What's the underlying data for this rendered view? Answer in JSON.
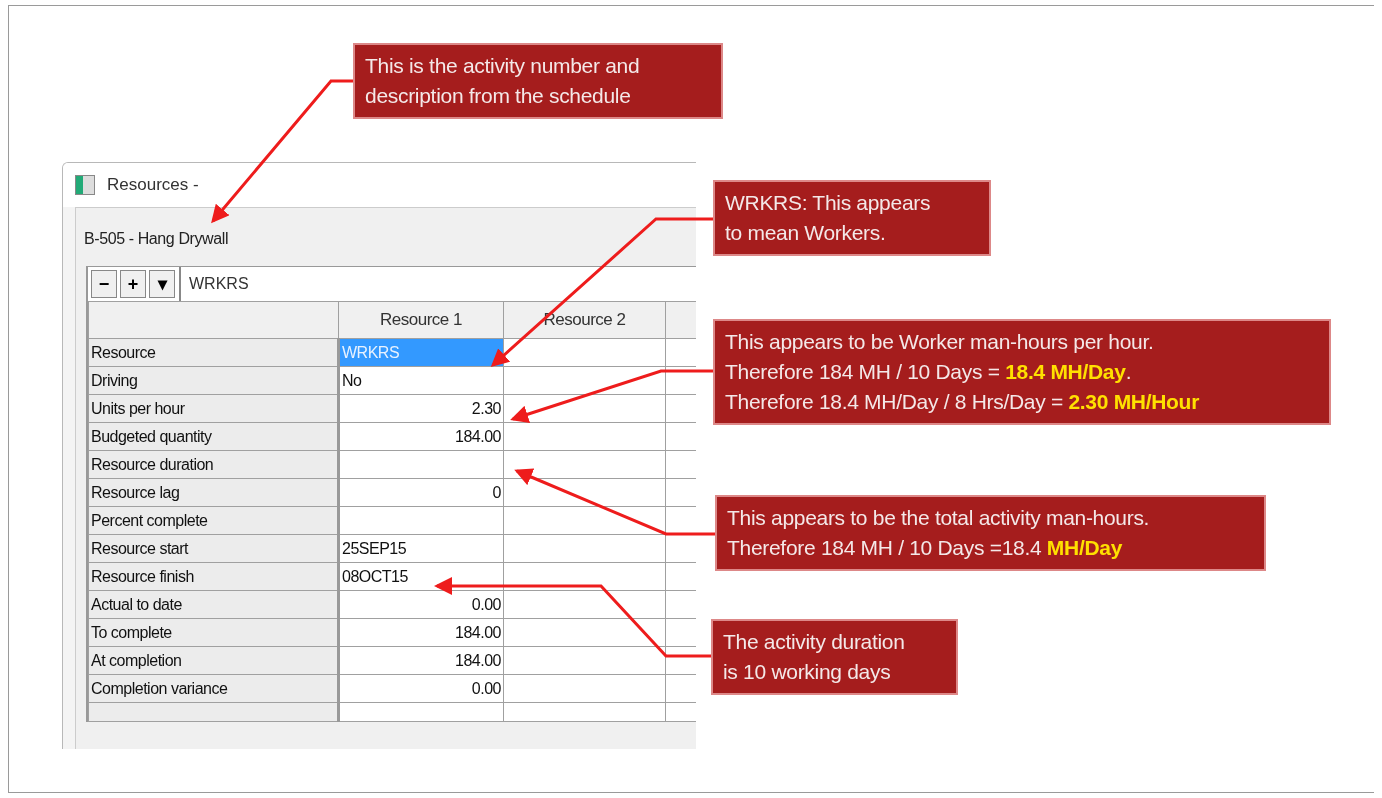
{
  "window": {
    "title": "Resources -",
    "activity": "B-505 - Hang Drywall"
  },
  "toolbar": {
    "buttons": [
      "−",
      "+",
      "▾"
    ],
    "value": "WRKRS"
  },
  "grid": {
    "columns": [
      "Resource 1",
      "Resource 2"
    ],
    "rows": [
      {
        "label": "Resource",
        "value": "WRKRS",
        "kind": "text",
        "selected": true
      },
      {
        "label": "Driving",
        "value": "No",
        "kind": "text",
        "selected": false
      },
      {
        "label": "Units per hour",
        "value": "2.30",
        "kind": "number",
        "selected": false
      },
      {
        "label": "Budgeted quantity",
        "value": "184.00",
        "kind": "number",
        "selected": false
      },
      {
        "label": "Resource duration",
        "selected": false
      },
      {
        "label": "Resource lag",
        "value": "0",
        "kind": "number",
        "selected": false
      },
      {
        "label": "Percent complete",
        "selected": false
      },
      {
        "label": "Resource start",
        "value": "25SEP15",
        "kind": "text",
        "selected": false
      },
      {
        "label": "Resource finish",
        "value": "08OCT15",
        "kind": "text",
        "selected": false
      },
      {
        "label": "Actual to date",
        "value": "0.00",
        "kind": "number",
        "selected": false
      },
      {
        "label": "To complete",
        "value": "184.00",
        "kind": "number",
        "selected": false
      },
      {
        "label": "At completion",
        "value": "184.00",
        "kind": "number",
        "selected": false
      },
      {
        "label": "Completion variance",
        "value": "0.00",
        "kind": "number",
        "selected": false
      }
    ]
  },
  "callouts": [
    {
      "lines": [
        [
          {
            "text": "This is the activity number and",
            "highlight": false
          }
        ],
        [
          {
            "text": "description from the schedule",
            "highlight": false
          }
        ]
      ]
    },
    {
      "lines": [
        [
          {
            "text": "WRKRS: This appears",
            "highlight": false
          }
        ],
        [
          {
            "text": "to mean Workers.",
            "highlight": false
          }
        ]
      ]
    },
    {
      "lines": [
        [
          {
            "text": "This appears to be Worker man-hours per hour.",
            "highlight": false
          }
        ],
        [
          {
            "text": "Therefore 184 MH / 10 Days = ",
            "highlight": false
          },
          {
            "text": "18.4 MH/Day",
            "highlight": true
          },
          {
            "text": ".",
            "highlight": false
          }
        ],
        [
          {
            "text": "Therefore 18.4 MH/Day / 8 Hrs/Day = ",
            "highlight": false
          },
          {
            "text": "2.30 MH/Hour",
            "highlight": true
          }
        ]
      ]
    },
    {
      "lines": [
        [
          {
            "text": "This appears to be the total activity man-hours.",
            "highlight": false
          }
        ],
        [
          {
            "text": "Therefore 184 MH / 10 Days =18.4 ",
            "highlight": false
          },
          {
            "text": "MH/Day",
            "highlight": true
          }
        ]
      ]
    },
    {
      "lines": [
        [
          {
            "text": "The activity duration",
            "highlight": false
          }
        ],
        [
          {
            "text": "is 10 working days",
            "highlight": false
          }
        ]
      ]
    }
  ]
}
